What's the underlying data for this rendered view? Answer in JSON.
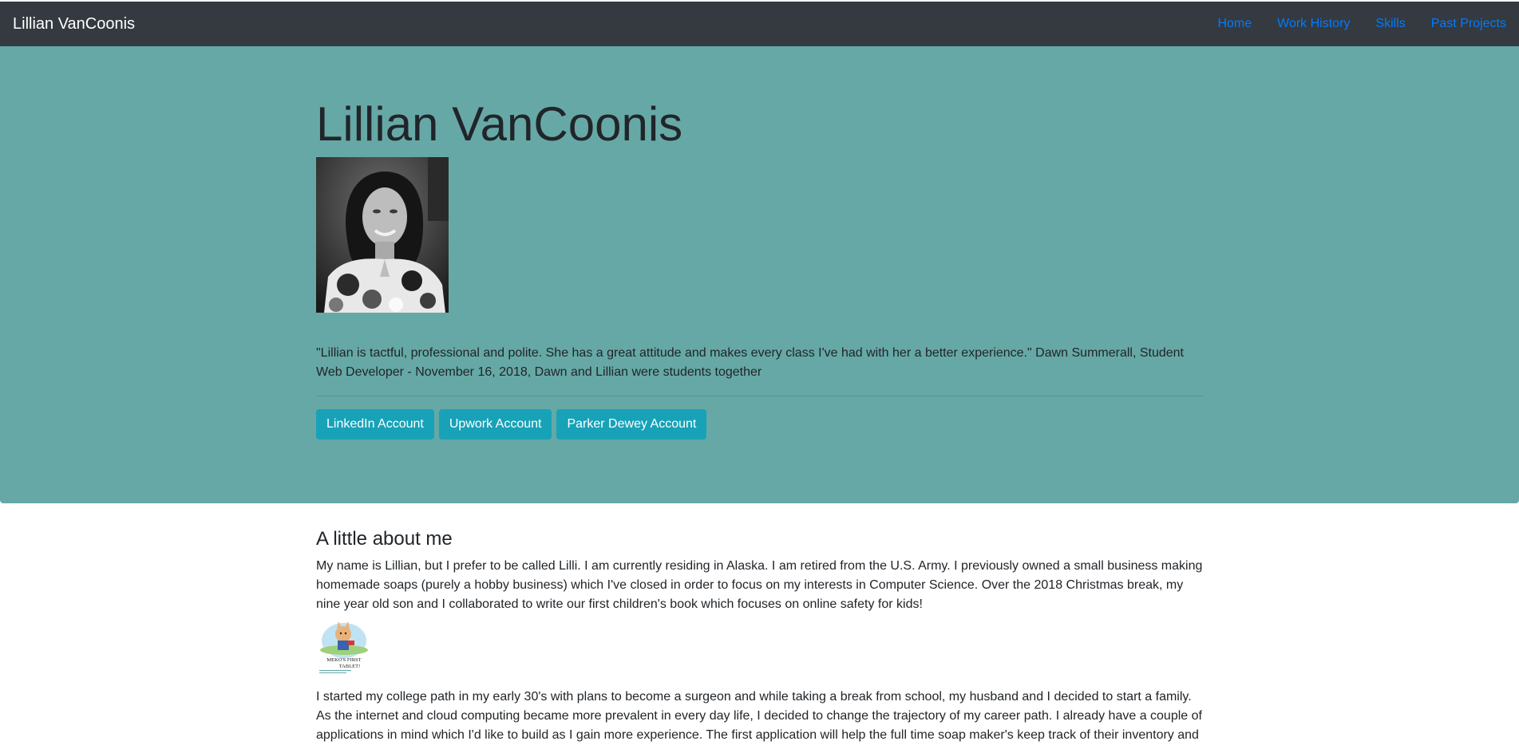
{
  "navbar": {
    "brand": "Lillian VanCoonis",
    "links": [
      {
        "label": "Home"
      },
      {
        "label": "Work History"
      },
      {
        "label": "Skills"
      },
      {
        "label": "Past Projects"
      }
    ]
  },
  "hero": {
    "title": "Lillian VanCoonis",
    "testimonial": "\"Lillian is tactful, professional and polite. She has a great attitude and makes every class I've had with her a better experience.\" Dawn Summerall, Student Web Developer - November 16, 2018, Dawn and Lillian were students together",
    "buttons": [
      {
        "label": "LinkedIn Account"
      },
      {
        "label": "Upwork Account"
      },
      {
        "label": "Parker Dewey Account"
      }
    ],
    "background_color": "#66a8a6"
  },
  "about": {
    "title": "A little about me",
    "paragraph1": "My name is Lillian, but I prefer to be called Lilli. I am currently residing in Alaska. I am retired from the U.S. Army. I previously owned a small business making homemade soaps (purely a hobby business) which I've closed in order to focus on my interests in Computer Science. Over the 2018 Christmas break, my nine year old son and I collaborated to write our first children's book which focuses on online safety for kids!",
    "book_cover_text": "MEKO'S FIRST TABLET!",
    "paragraph2": "I started my college path in my early 30's with plans to become a surgeon and while taking a break from school, my husband and I decided to start a family. As the internet and cloud computing became more prevalent in every day life, I decided to change the trajectory of my career path. I already have a couple of applications in mind which I'd like to build as I gain more experience. The first application will help the full time soap maker's keep track of their inventory and"
  },
  "colors": {
    "navbar": "#343a40",
    "nav_link": "#007bff",
    "button": "#17a2b8"
  }
}
